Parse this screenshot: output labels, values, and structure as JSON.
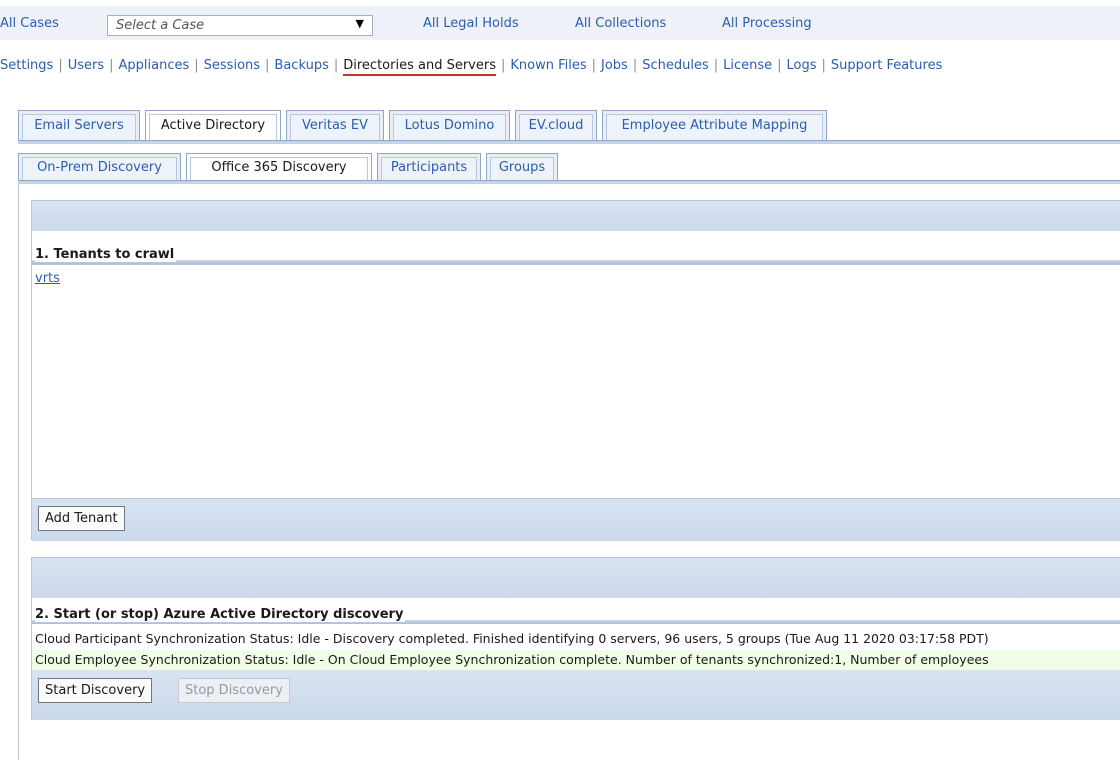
{
  "topbar": {
    "all_cases": "All Cases",
    "case_placeholder": "Select a Case",
    "all_legal_holds": "All Legal Holds",
    "all_collections": "All Collections",
    "all_processing": "All Processing"
  },
  "settings_nav": {
    "items": [
      "Settings",
      "Users",
      "Appliances",
      "Sessions",
      "Backups",
      "Directories and Servers",
      "Known Files",
      "Jobs",
      "Schedules",
      "License",
      "Logs",
      "Support Features"
    ],
    "active": "Directories and Servers"
  },
  "main_tabs": {
    "items": [
      "Email Servers",
      "Active Directory",
      "Veritas EV",
      "Lotus Domino",
      "EV.cloud",
      "Employee Attribute Mapping"
    ],
    "selected": "Active Directory"
  },
  "sub_tabs": {
    "items": [
      "On-Prem Discovery",
      "Office 365 Discovery",
      "Participants",
      "Groups"
    ],
    "selected": "Office 365 Discovery"
  },
  "tenants": {
    "title": "1. Tenants to crawl",
    "list": [
      "vrts"
    ],
    "add_button": "Add Tenant"
  },
  "discovery": {
    "title": "2. Start (or stop) Azure Active Directory discovery",
    "status1": "Cloud Participant Synchronization Status: Idle - Discovery completed. Finished identifying 0 servers, 96 users, 5 groups (Tue Aug 11 2020 03:17:58 PDT)",
    "status2": "Cloud Employee Synchronization Status: Idle - On Cloud Employee Synchronization complete. Number of tenants synchronized:1, Number of employees",
    "start_button": "Start Discovery",
    "stop_button": "Stop Discovery"
  }
}
